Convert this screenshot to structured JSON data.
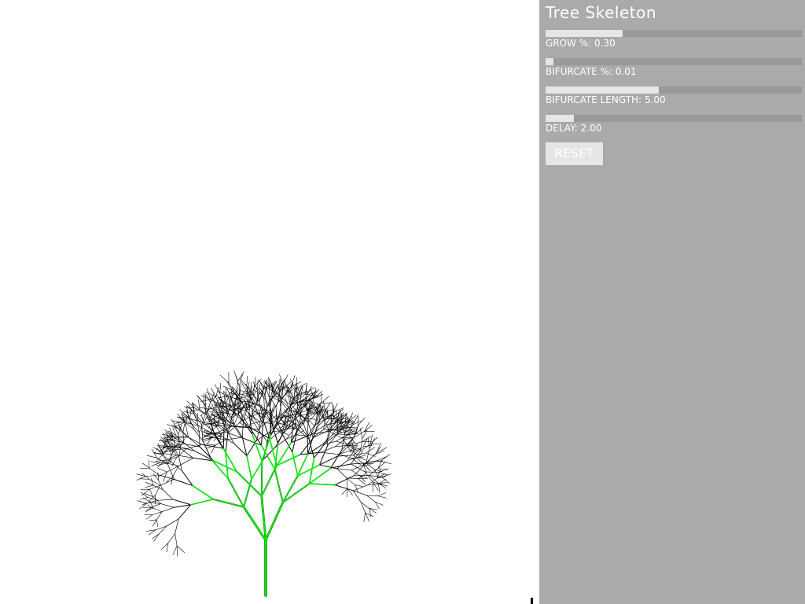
{
  "panel": {
    "title": "Tree Skeleton",
    "sliders": [
      {
        "id": "grow",
        "label": "GROW %: 0.30",
        "value": 0.3,
        "min": 0,
        "max": 1
      },
      {
        "id": "bifurcate",
        "label": "BIFURCATE %: 0.01",
        "value": 0.01,
        "min": 0,
        "max": 1
      },
      {
        "id": "bifurcate-length",
        "label": "BIFURCATE LENGTH: 5.00",
        "value": 5.0,
        "min": 0,
        "max": 11.3
      },
      {
        "id": "delay",
        "label": "DELAY: 2.00",
        "value": 2.0,
        "min": 0,
        "max": 18
      }
    ],
    "reset_label": "RESET"
  },
  "colors": {
    "canvas_bg": "#ffffff",
    "panel_bg": "#aaaaaa",
    "slider_track": "#999999",
    "slider_fill": "#e6e6e6",
    "text": "#ffffff",
    "branch": "#000000",
    "trunk_highlight": "#00ee00"
  }
}
